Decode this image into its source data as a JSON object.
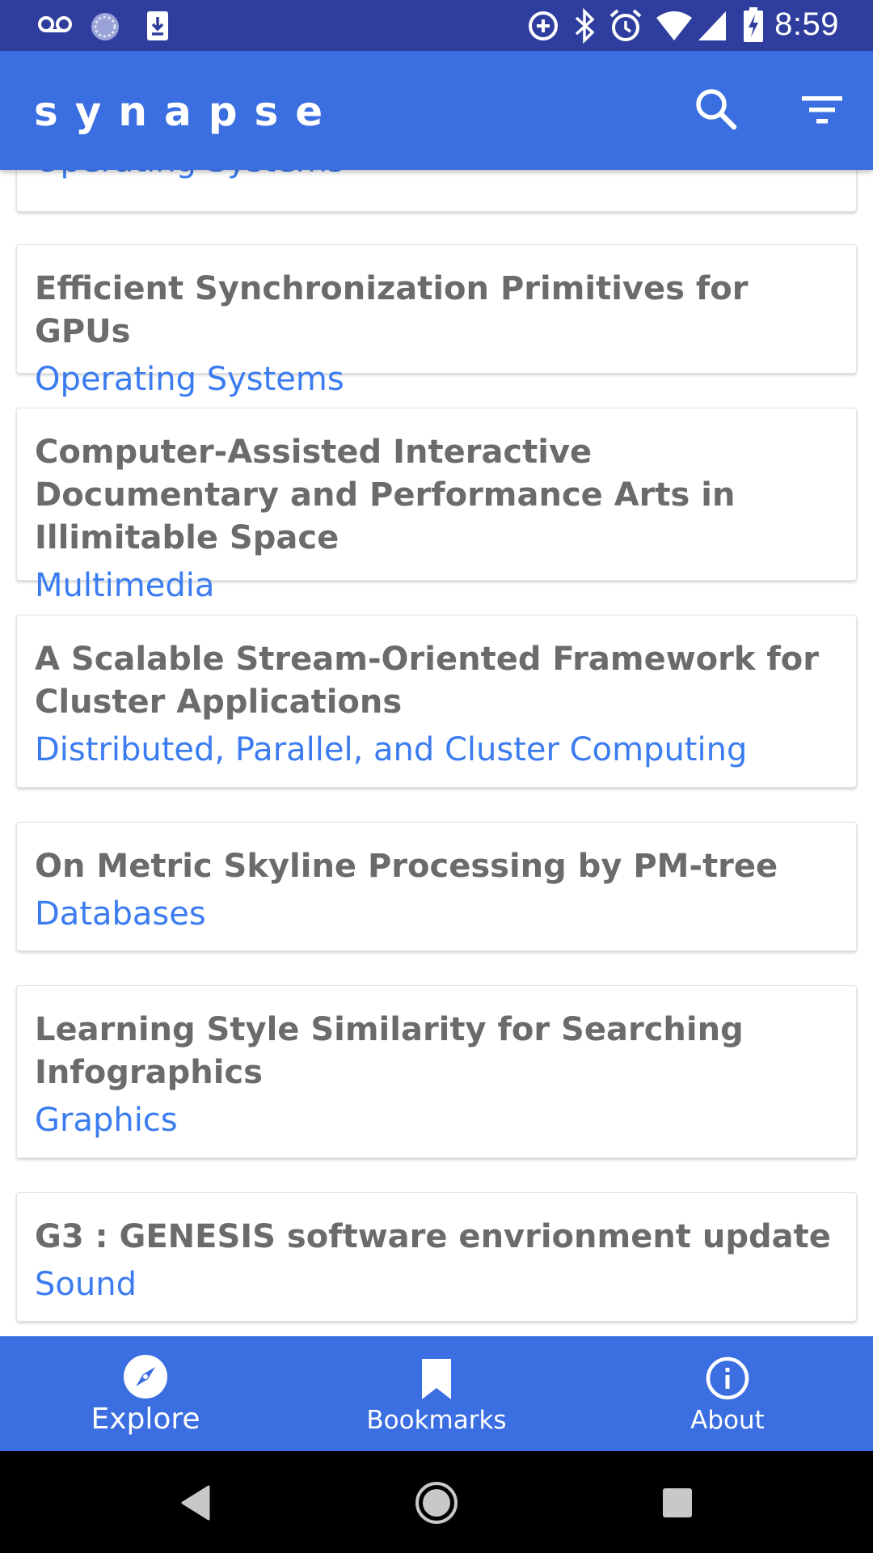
{
  "status_bar": {
    "time": "8:59",
    "left_icons": [
      "voicemail-icon",
      "sync-icon",
      "download-icon"
    ],
    "right_icons": [
      "data-saver-icon",
      "bluetooth-icon",
      "alarm-icon",
      "wifi-icon",
      "cell-signal-icon",
      "battery-charging-icon"
    ]
  },
  "app_bar": {
    "title": "synapse",
    "actions": [
      "search-icon",
      "filter-icon"
    ]
  },
  "colors": {
    "app_bar": "#3b6ee0",
    "status_bar": "#2f3e9e",
    "title_text": "#6b6b6b",
    "category_text": "#3b7cf0"
  },
  "papers": [
    {
      "title": "",
      "category": "Operating Systems"
    },
    {
      "title": "Efficient Synchronization Primitives for GPUs",
      "category": "Operating Systems"
    },
    {
      "title": "Computer-Assisted Interactive Documentary and Performance Arts in Illimitable Space",
      "category": "Multimedia"
    },
    {
      "title": "A Scalable Stream-Oriented Framework for Cluster Applications",
      "category": "Distributed, Parallel, and Cluster Computing"
    },
    {
      "title": "On Metric Skyline Processing by PM-tree",
      "category": "Databases"
    },
    {
      "title": "Learning Style Similarity for Searching Infographics",
      "category": "Graphics"
    },
    {
      "title": "G3 : GENESIS software envrionment update",
      "category": "Sound"
    }
  ],
  "bottom_nav": {
    "items": [
      {
        "label": "Explore",
        "icon": "compass-icon",
        "active": true
      },
      {
        "label": "Bookmarks",
        "icon": "bookmark-icon",
        "active": false
      },
      {
        "label": "About",
        "icon": "info-icon",
        "active": false
      }
    ]
  },
  "system_nav": [
    "back-icon",
    "home-icon",
    "recents-icon"
  ]
}
